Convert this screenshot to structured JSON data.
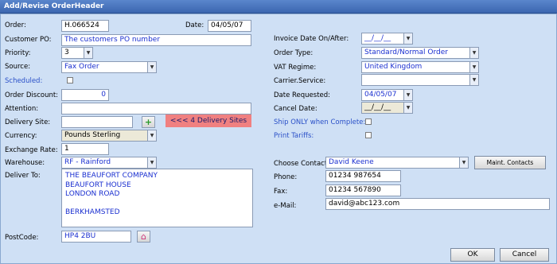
{
  "window": {
    "title": "Add/Revise OrderHeader"
  },
  "left": {
    "order_label": "Order:",
    "order_value": "H.066524",
    "date_label": "Date:",
    "date_value": "04/05/07",
    "customer_po_label": "Customer PO:",
    "customer_po_value": "The customers PO number",
    "priority_label": "Priority:",
    "priority_value": "3",
    "source_label": "Source:",
    "source_value": "Fax Order",
    "scheduled_label": "Scheduled:",
    "order_discount_label": "Order Discount:",
    "order_discount_value": "0",
    "attention_label": "Attention:",
    "attention_value": "",
    "delivery_site_label": "Delivery Site:",
    "delivery_site_value": "",
    "delivery_sites_note": "<<< 4 Delivery Sites",
    "currency_label": "Currency:",
    "currency_value": "Pounds Sterling",
    "exchange_rate_label": "Exchange Rate:",
    "exchange_rate_value": "1",
    "warehouse_label": "Warehouse:",
    "warehouse_value": "RF - Rainford",
    "deliver_to_label": "Deliver To:",
    "deliver_to_value": "THE BEAUFORT COMPANY\nBEAUFORT HOUSE\nLONDON ROAD\n\nBERKHAMSTED",
    "postcode_label": "PostCode:",
    "postcode_value": "HP4 2BU"
  },
  "right": {
    "invoice_date_label": "Invoice Date On/After:",
    "invoice_date_value": "__/__/__",
    "order_type_label": "Order Type:",
    "order_type_value": "Standard/Normal Order",
    "vat_regime_label": "VAT Regime:",
    "vat_regime_value": "United Kingdom",
    "carrier_service_label": "Carrier.Service:",
    "carrier_service_value": "",
    "date_requested_label": "Date Requested:",
    "date_requested_value": "04/05/07",
    "cancel_date_label": "Cancel Date:",
    "cancel_date_value": "__/__/__",
    "ship_only_label": "Ship ONLY when Complete:",
    "print_tariffs_label": "Print Tariffs:",
    "choose_contact_label": "Choose Contact:",
    "choose_contact_value": "David Keene",
    "maint_contacts_label": "Maint. Contacts",
    "phone_label": "Phone:",
    "phone_value": "01234 987654",
    "fax_label": "Fax:",
    "fax_value": "01234 567890",
    "email_label": "e-Mail:",
    "email_value": "david@abc123.com"
  },
  "footer": {
    "ok_label": "OK",
    "cancel_label": "Cancel"
  },
  "icons": {
    "add": "plus-icon",
    "home": "house-icon",
    "dropdown": "chevron-down-icon"
  }
}
